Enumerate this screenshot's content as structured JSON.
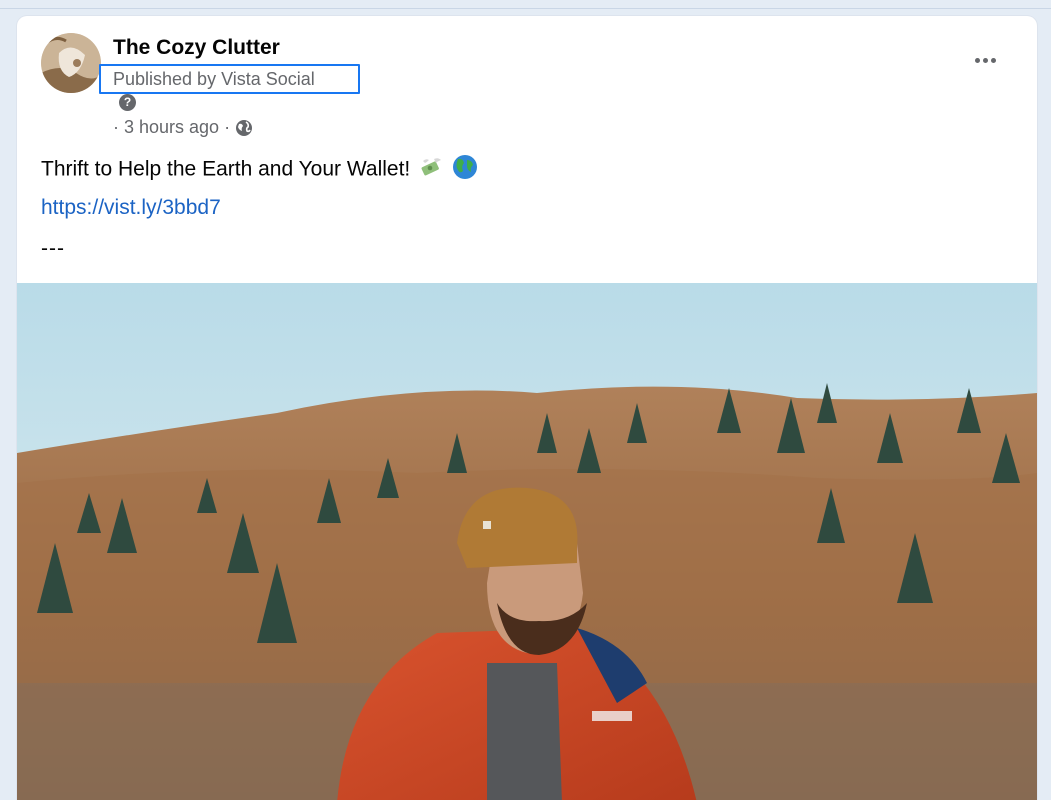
{
  "post": {
    "page_name": "The Cozy Clutter",
    "publisher_label": "Published by Vista Social",
    "help_glyph": "?",
    "meta_separator": "·",
    "timestamp": "3 hours ago",
    "audience_icon": "globe-icon",
    "text": "Thrift to Help the Earth and Your Wallet!",
    "text_emojis": [
      "money-with-wings-emoji",
      "globe-emoji"
    ],
    "link": "https://vist.ly/3bbd7",
    "separator_line": "---",
    "image": "photo-bearded-man-orange-jacket-beanie-forest-hillside"
  },
  "colors": {
    "accent_highlight": "#1877f2",
    "link": "#1b63c4",
    "secondary_text": "#65676b",
    "primary_text": "#050505",
    "page_background": "#e4ecf5"
  }
}
